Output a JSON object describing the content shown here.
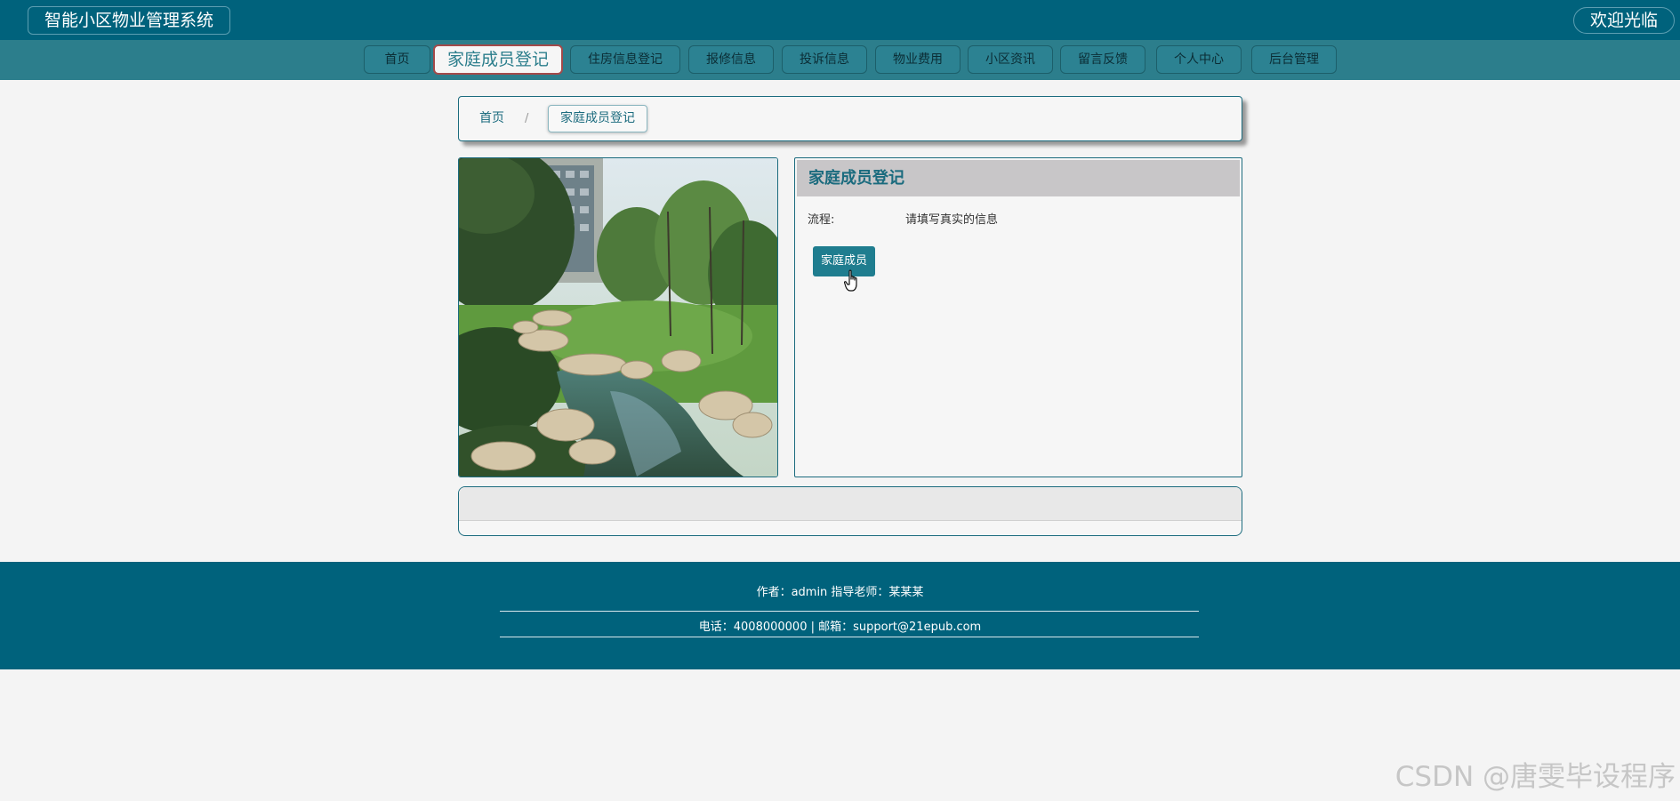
{
  "header": {
    "site_title": "智能小区物业管理系统",
    "welcome": "欢迎光临"
  },
  "nav": {
    "items": [
      {
        "label": "首页"
      },
      {
        "label": "家庭成员登记",
        "active": true
      },
      {
        "label": "住房信息登记"
      },
      {
        "label": "报修信息"
      },
      {
        "label": "投诉信息"
      },
      {
        "label": "物业费用"
      },
      {
        "label": "小区资讯"
      },
      {
        "label": "留言反馈"
      },
      {
        "label": "个人中心"
      },
      {
        "label": "后台管理"
      }
    ]
  },
  "breadcrumb": {
    "home": "首页",
    "separator": "/",
    "current": "家庭成员登记"
  },
  "panel": {
    "title": "家庭成员登记",
    "flow_label": "流程:",
    "flow_text": "请填写真实的信息",
    "button_label": "家庭成员"
  },
  "footer": {
    "line1": "作者：admin 指导老师：某某某",
    "line2": "电话：4008000000 | 邮箱：support@21epub.com"
  },
  "watermark": "CSDN @唐雯毕设程序",
  "colors": {
    "header_bg": "#00627c",
    "nav_bg": "#2c7e8c",
    "accent": "#1b6b7e",
    "button_bg": "#1f7d8f"
  }
}
